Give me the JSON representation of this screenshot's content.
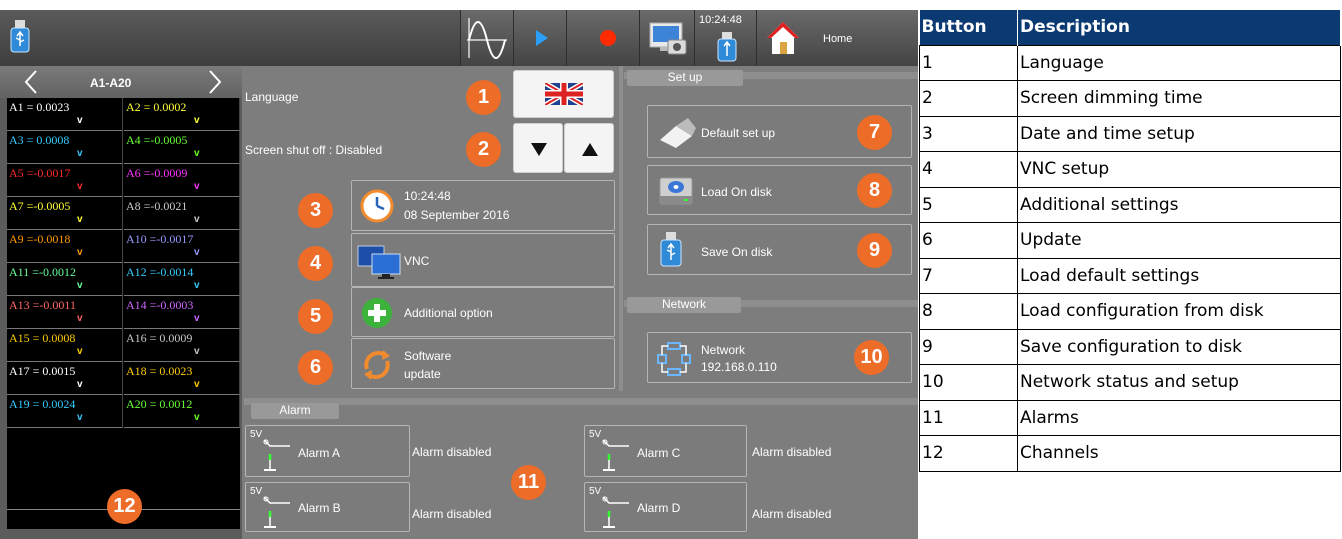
{
  "topbar": {
    "time": "10:24:48",
    "home_label": "Home"
  },
  "channels": {
    "nav_title": "A1-A20",
    "items": [
      {
        "label": "A1 = 0.0023",
        "unit": "v",
        "color": "#ffffff"
      },
      {
        "label": "A2 = 0.0002",
        "unit": "v",
        "color": "#ffff33"
      },
      {
        "label": "A3 = 0.0008",
        "unit": "v",
        "color": "#33ccff"
      },
      {
        "label": "A4 =-0.0005",
        "unit": "v",
        "color": "#66ff33"
      },
      {
        "label": "A5 =-0.0017",
        "unit": "v",
        "color": "#ff2a2a"
      },
      {
        "label": "A6 =-0.0009",
        "unit": "v",
        "color": "#ff33ff"
      },
      {
        "label": "A7 =-0.0005",
        "unit": "v",
        "color": "#ffff33"
      },
      {
        "label": "A8 =-0.0021",
        "unit": "v",
        "color": "#c8c8c8"
      },
      {
        "label": "A9 =-0.0018",
        "unit": "v",
        "color": "#ff9900"
      },
      {
        "label": "A10 =-0.0017",
        "unit": "v",
        "color": "#9999ff"
      },
      {
        "label": "A11 =-0.0012",
        "unit": "v",
        "color": "#66ff99"
      },
      {
        "label": "A12 =-0.0014",
        "unit": "v",
        "color": "#33ccff"
      },
      {
        "label": "A13 =-0.0011",
        "unit": "v",
        "color": "#ff6666"
      },
      {
        "label": "A14 =-0.0003",
        "unit": "v",
        "color": "#cc66ff"
      },
      {
        "label": "A15 = 0.0008",
        "unit": "v",
        "color": "#ffcc00"
      },
      {
        "label": "A16 = 0.0009",
        "unit": "v",
        "color": "#c8c8c8"
      },
      {
        "label": "A17 = 0.0015",
        "unit": "v",
        "color": "#ffffff"
      },
      {
        "label": "A18 = 0.0023",
        "unit": "v",
        "color": "#ffcc00"
      },
      {
        "label": "A19 = 0.0024",
        "unit": "v",
        "color": "#33ccff"
      },
      {
        "label": "A20 = 0.0012",
        "unit": "v",
        "color": "#66ff33"
      }
    ]
  },
  "settings": {
    "language_label": "Language",
    "screen_shutoff_label": "Screen shut off : Disabled",
    "date_time": "10:24:48",
    "date": "08 September 2016",
    "vnc_label": "VNC",
    "additional_label": "Additional option",
    "software_label": "Software",
    "update_label": "update"
  },
  "setup": {
    "tab": "Set up",
    "default_label": "Default set up",
    "load_label": "Load On disk",
    "save_label": "Save On disk"
  },
  "network": {
    "tab": "Network",
    "label": "Network",
    "ip": "192.168.0.110"
  },
  "alarm": {
    "tab": "Alarm",
    "prefix": "5V",
    "a_label": "Alarm  A",
    "b_label": "Alarm  B",
    "c_label": "Alarm  C",
    "d_label": "Alarm  D",
    "a_status": "Alarm disabled",
    "b_status": "Alarm disabled",
    "c_status": "Alarm disabled",
    "d_status": "Alarm disabled"
  },
  "badges": [
    "1",
    "2",
    "3",
    "4",
    "5",
    "6",
    "7",
    "8",
    "9",
    "10",
    "11",
    "12"
  ],
  "table": {
    "headers": [
      "Button",
      "Description"
    ],
    "rows": [
      [
        "1",
        "Language"
      ],
      [
        "2",
        "Screen dimming time"
      ],
      [
        "3",
        "Date and time setup"
      ],
      [
        "4",
        "VNC setup"
      ],
      [
        "5",
        "Additional settings"
      ],
      [
        "6",
        "Update"
      ],
      [
        "7",
        "Load default settings"
      ],
      [
        "8",
        "Load configuration from disk"
      ],
      [
        "9",
        "Save configuration to disk"
      ],
      [
        "10",
        "Network status and setup"
      ],
      [
        "11",
        "Alarms"
      ],
      [
        "12",
        "Channels"
      ]
    ]
  },
  "colors": {
    "header_blue": "#0b3a72",
    "badge_orange": "#ec6c28"
  },
  "icons": [
    "usb-icon",
    "waveform-icon",
    "play-icon",
    "record-icon",
    "screenshot-icon",
    "home-icon",
    "uk-flag-icon",
    "arrow-down-icon",
    "arrow-up-icon",
    "clock-icon",
    "monitor-icon",
    "plus-icon",
    "refresh-icon",
    "eraser-icon",
    "disk-icon",
    "network-icon",
    "relay-icon",
    "chevron-left-icon",
    "chevron-right-icon"
  ]
}
